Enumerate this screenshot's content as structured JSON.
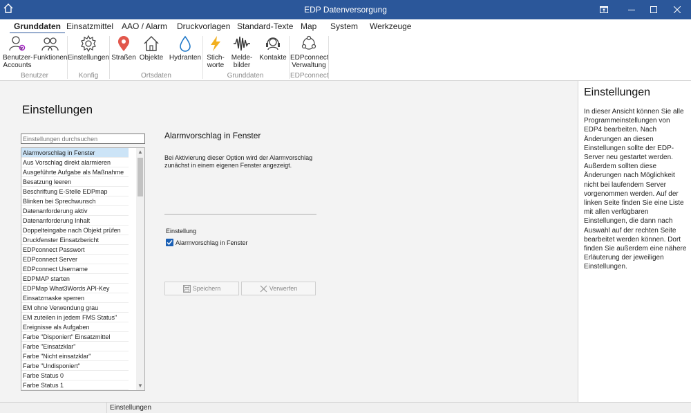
{
  "window": {
    "title": "EDP Datenversorgung",
    "accent": "#2b579a"
  },
  "menu": {
    "tabs": [
      {
        "label": "Grunddaten",
        "active": true
      },
      {
        "label": "Einsatzmittel"
      },
      {
        "label": "AAO / Alarm"
      },
      {
        "label": "Druckvorlagen"
      },
      {
        "label": "Standard-Texte"
      },
      {
        "label": "Map"
      },
      {
        "label": "System"
      },
      {
        "label": "Werkzeuge"
      }
    ]
  },
  "ribbon": {
    "buttons": [
      {
        "line1": "Benutzer-",
        "line2": "Accounts",
        "icon": "users-gear-icon"
      },
      {
        "line1": "Funktionen",
        "line2": "",
        "icon": "people-icon"
      },
      {
        "line1": "Einstellungen",
        "line2": "",
        "icon": "gear-icon"
      },
      {
        "line1": "Straßen",
        "line2": "",
        "icon": "map-pin-icon"
      },
      {
        "line1": "Objekte",
        "line2": "",
        "icon": "house-icon"
      },
      {
        "line1": "Hydranten",
        "line2": "",
        "icon": "water-drop-icon"
      },
      {
        "line1": "Stich-",
        "line2": "worte",
        "icon": "lightning-icon"
      },
      {
        "line1": "Melde-",
        "line2": "bilder",
        "icon": "waveform-icon"
      },
      {
        "line1": "Kontakte",
        "line2": "",
        "icon": "headset-icon"
      },
      {
        "line1": "EDPconnect",
        "line2": "Verwaltung",
        "icon": "network-icon"
      }
    ],
    "groups": [
      "Benutzer",
      "Konfig",
      "Ortsdaten",
      "Grunddaten",
      "EDPconnect"
    ]
  },
  "main": {
    "page_title": "Einstellungen",
    "search_placeholder": "Einstellungen durchsuchen",
    "list_items": [
      "Alarmvorschlag in Fenster",
      "Aus Vorschlag direkt alarmieren",
      "Ausgeführte Aufgabe als Maßnahme",
      "Besatzung leeren",
      "Beschriftung E-Stelle EDPmap",
      "Blinken bei Sprechwunsch",
      "Datenanforderung aktiv",
      "Datenanforderung Inhalt",
      "Doppelteingabe nach Objekt prüfen",
      "Druckfenster Einsatzbericht",
      "EDPconnect Passwort",
      "EDPconnect Server",
      "EDPconnect Username",
      "EDPMAP starten",
      "EDPMap What3Words API-Key",
      "Einsatzmaske sperren",
      "EM ohne Verwendung grau",
      "EM zuteilen in jedem FMS Status\"",
      "Ereignisse als Aufgaben",
      "Farbe \"Disponiert\" Einsatzmittel",
      "Farbe \"Einsatzklar\"",
      "Farbe \"Nicht einsatzklar\"",
      "Farbe \"Undisponiert\"",
      "Farbe Status 0",
      "Farbe Status 1"
    ],
    "selected_index": 0,
    "detail": {
      "title": "Alarmvorschlag in Fenster",
      "description": "Bei Aktivierung dieser Option wird der Alarmvorschlag zunächst in einem eigenen Fenster angezeigt.",
      "setting_label": "Einstellung",
      "checkbox_label": "Alarmvorschlag in Fenster",
      "checkbox_checked": true,
      "save_label": "Speichern",
      "discard_label": "Verwerfen"
    }
  },
  "sidebar": {
    "title": "Einstellungen",
    "text": "In dieser Ansicht können Sie alle Programmeinstellungen von EDP4 bearbeiten. Nach Änderungen an diesen Einstellungen sollte der EDP-Server neu gestartet werden. Außerdem sollten diese Änderungen nach Möglichkeit nicht bei laufendem Server vorgenommen werden. Auf der linken Seite finden Sie eine Liste mit allen verfügbaren Einstellungen, die dann nach Auswahl auf der rechten Seite bearbeitet werden können. Dort finden Sie außerdem eine nähere Erläuterung der jeweiligen Einstellungen."
  },
  "status": {
    "text": "Einstellungen"
  }
}
